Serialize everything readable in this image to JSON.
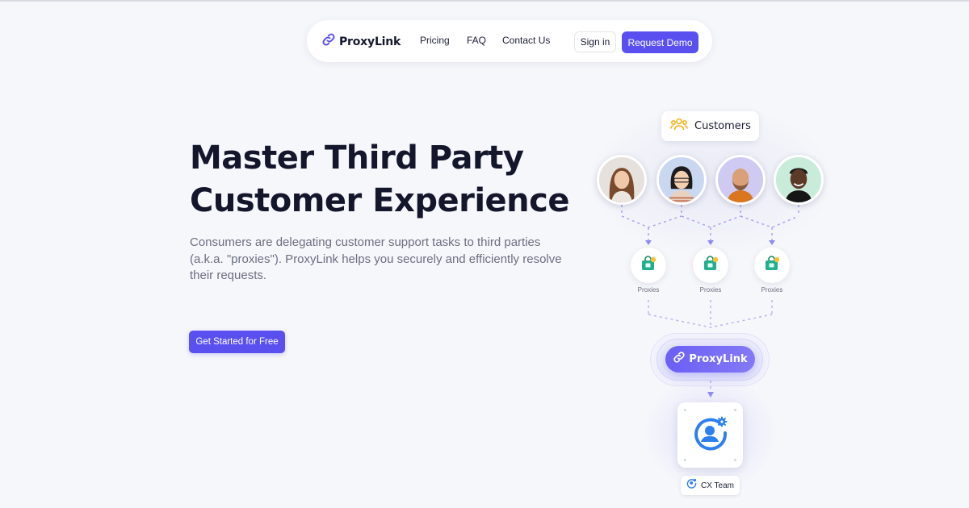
{
  "nav": {
    "brand": "ProxyLink",
    "links": [
      "Pricing",
      "FAQ",
      "Contact Us"
    ],
    "signin_label": "Sign in",
    "demo_label": "Request Demo"
  },
  "hero": {
    "title_line1": "Master Third Party",
    "title_line2": "Customer Experience",
    "subtitle": "Consumers are delegating customer support tasks to third parties (a.k.a. \"proxies\"). ProxyLink helps you securely and efficiently resolve their requests.",
    "cta_label": "Get Started for Free"
  },
  "diagram": {
    "customers_label": "Customers",
    "proxy_labels": [
      "Proxies",
      "Proxies",
      "Proxies"
    ],
    "hub_label": "ProxyLink",
    "team_label": "CX Team"
  },
  "colors": {
    "accent": "#5a50f0",
    "background": "#f6f7fb",
    "text": "#14162b",
    "muted": "#6b6f80"
  },
  "icons": [
    "link-icon",
    "customers-icon",
    "proxy-bag-icon",
    "cx-team-icon",
    "gear-icon"
  ]
}
